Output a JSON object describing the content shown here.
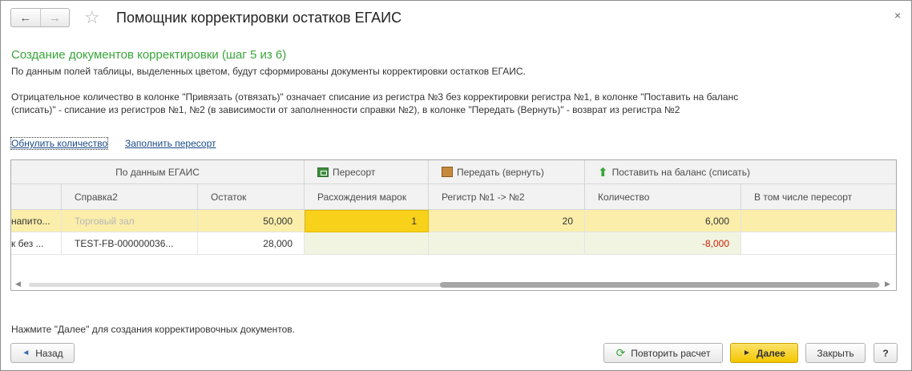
{
  "window": {
    "title": "Помощник корректировки остатков ЕГАИС",
    "close_glyph": "×",
    "back_glyph": "←",
    "forward_glyph": "→",
    "star_glyph": "☆"
  },
  "step": {
    "heading": "Создание документов корректировки (шаг 5 из 6)",
    "description": "По данным полей таблицы, выделенных цветом, будут сформированы документы корректировки остатков ЕГАИС.",
    "explanation": "Отрицательное количество в колонке \"Привязать (отвязать)\" означает списание из регистра №3 без корректировки регистра №1, в колонке \"Поставить на баланс (списать)\" - списание из регистров №1, №2 (в зависимости от заполненности справки №2), в колонке \"Передать (Вернуть)\" - возврат из регистра №2"
  },
  "links": {
    "reset_quantity": "Обнулить количество",
    "fill_resort": "Заполнить пересорт"
  },
  "table": {
    "group_headers": {
      "egais": "По данным ЕГАИС",
      "resort": "Пересорт",
      "transfer": "Передать (вернуть)",
      "balance": "Поставить на баланс (списать)"
    },
    "columns": {
      "certificate2": "Справка2",
      "remainder": "Остаток",
      "mark_diff": "Расхождения марок",
      "register": "Регистр №1 -> №2",
      "quantity": "Количество",
      "incl_resort": "В том числе пересорт"
    },
    "rows": [
      {
        "name": "напито...",
        "certificate2": "Торговый зал",
        "remainder": "50,000",
        "mark_diff": "1",
        "register": "20",
        "quantity": "6,000",
        "incl_resort": ""
      },
      {
        "name": "к без ...",
        "certificate2": "TEST-FB-000000036...",
        "remainder": "28,000",
        "mark_diff": "",
        "register": "",
        "quantity": "-8,000",
        "incl_resort": ""
      }
    ]
  },
  "footer": {
    "hint": "Нажмите \"Далее\" для создания корректировочных документов.",
    "back_label": "Назад",
    "repeat_label": "Повторить расчет",
    "next_label": "Далее",
    "close_label": "Закрыть",
    "help_label": "?"
  },
  "colors": {
    "heading_green": "#3aa53a",
    "selected_row": "#fbeeaa",
    "selected_cell": "#f8d11a",
    "negative": "#cc2200",
    "primary_button": "#f3c600"
  }
}
